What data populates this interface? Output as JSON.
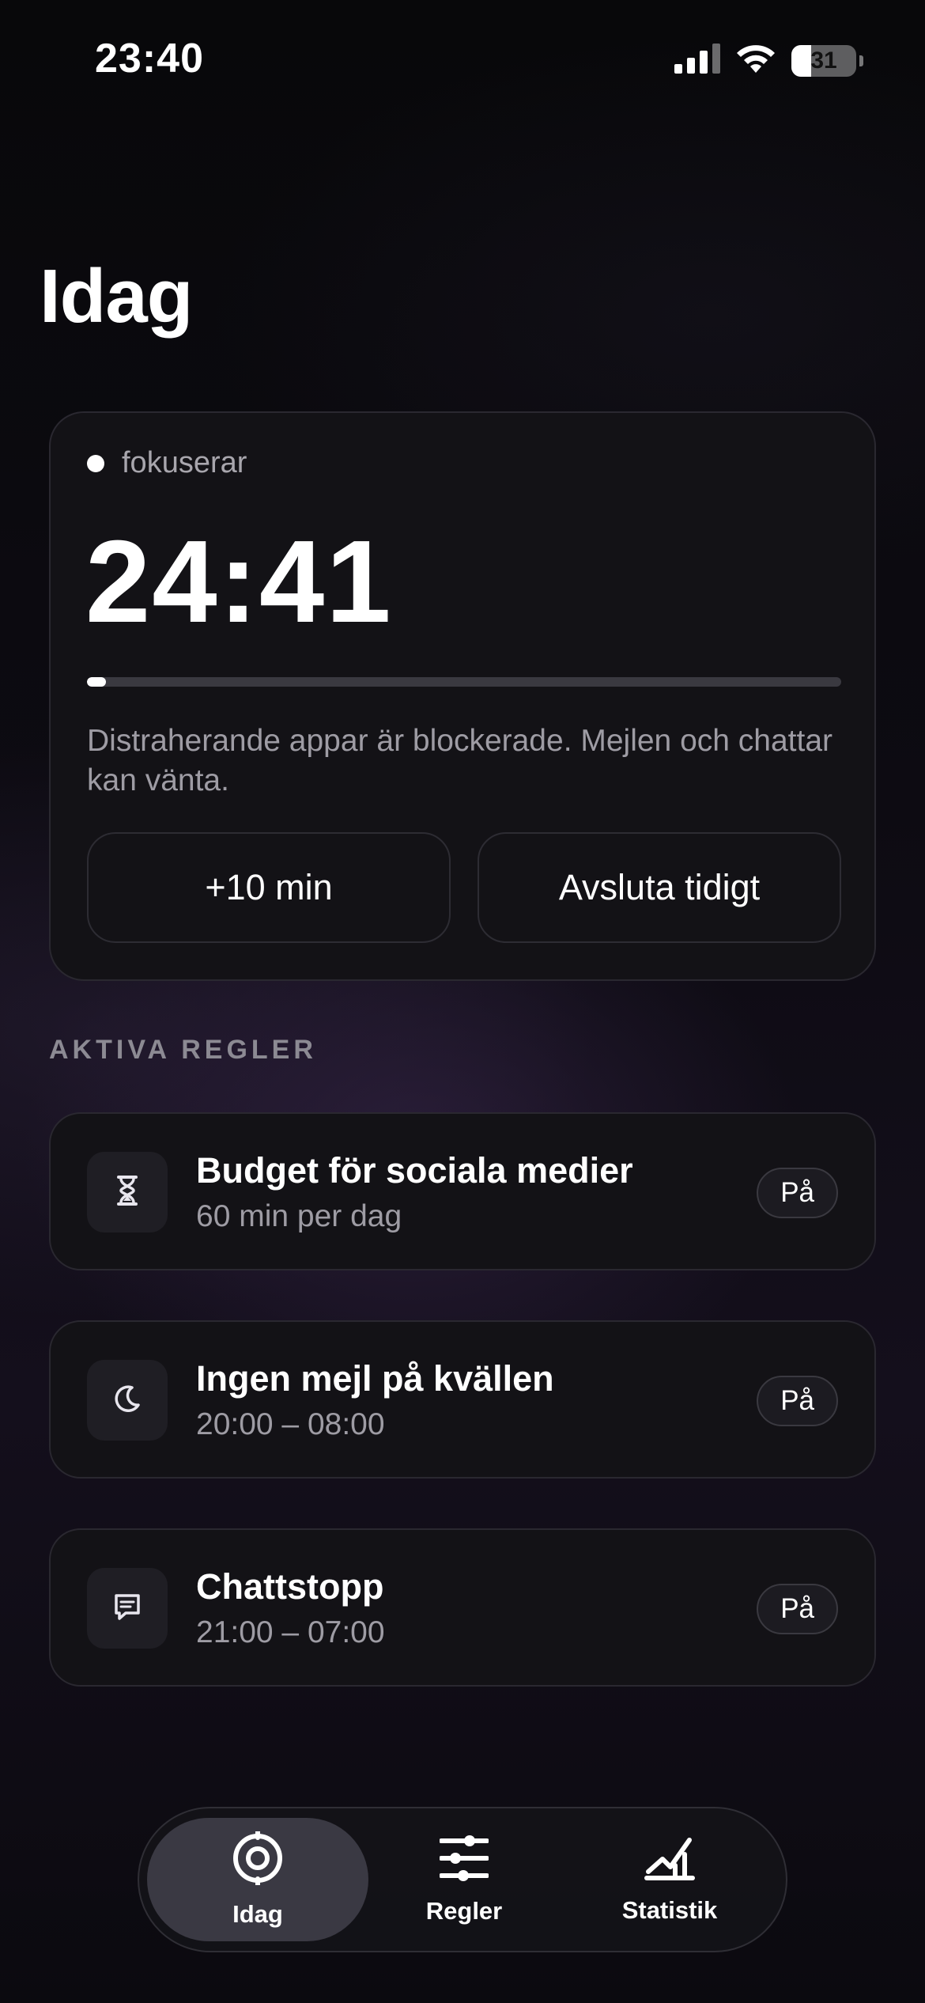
{
  "status_bar": {
    "time": "23:40",
    "battery_level": "31",
    "battery_fraction": 0.31,
    "icons": [
      "signal-icon",
      "wifi-icon",
      "battery-icon"
    ]
  },
  "header": {
    "title": "Idag"
  },
  "focus": {
    "status_label": "fokuserar",
    "timer": "24:41",
    "progress": 0.025,
    "description": "Distraherande appar är blockerade. Mejlen och chattar kan vänta.",
    "extend_button": "+10 min",
    "end_button": "Avsluta tidigt"
  },
  "rules": {
    "section_title": "AKTIVA REGLER",
    "items": [
      {
        "title": "Budget för sociala medier",
        "subtitle": "60 min per dag",
        "badge": "På",
        "icon": "hourglass-icon"
      },
      {
        "title": "Ingen mejl på kvällen",
        "subtitle": "20:00 – 08:00",
        "badge": "På",
        "icon": "moon-icon"
      },
      {
        "title": "Chattstopp",
        "subtitle": "21:00 – 07:00",
        "badge": "På",
        "icon": "chat-bubble-icon"
      }
    ]
  },
  "tab_bar": {
    "tabs": [
      {
        "label": "Idag",
        "icon": "target-icon",
        "active": true
      },
      {
        "label": "Regler",
        "icon": "sliders-icon",
        "active": false
      },
      {
        "label": "Statistik",
        "icon": "chart-icon",
        "active": false
      }
    ]
  },
  "colors": {
    "background": "#0a090d",
    "card": "#131216",
    "card_border": "#2a2830",
    "secondary_text": "#9e9ca4",
    "active_tab": "#3a3943"
  }
}
